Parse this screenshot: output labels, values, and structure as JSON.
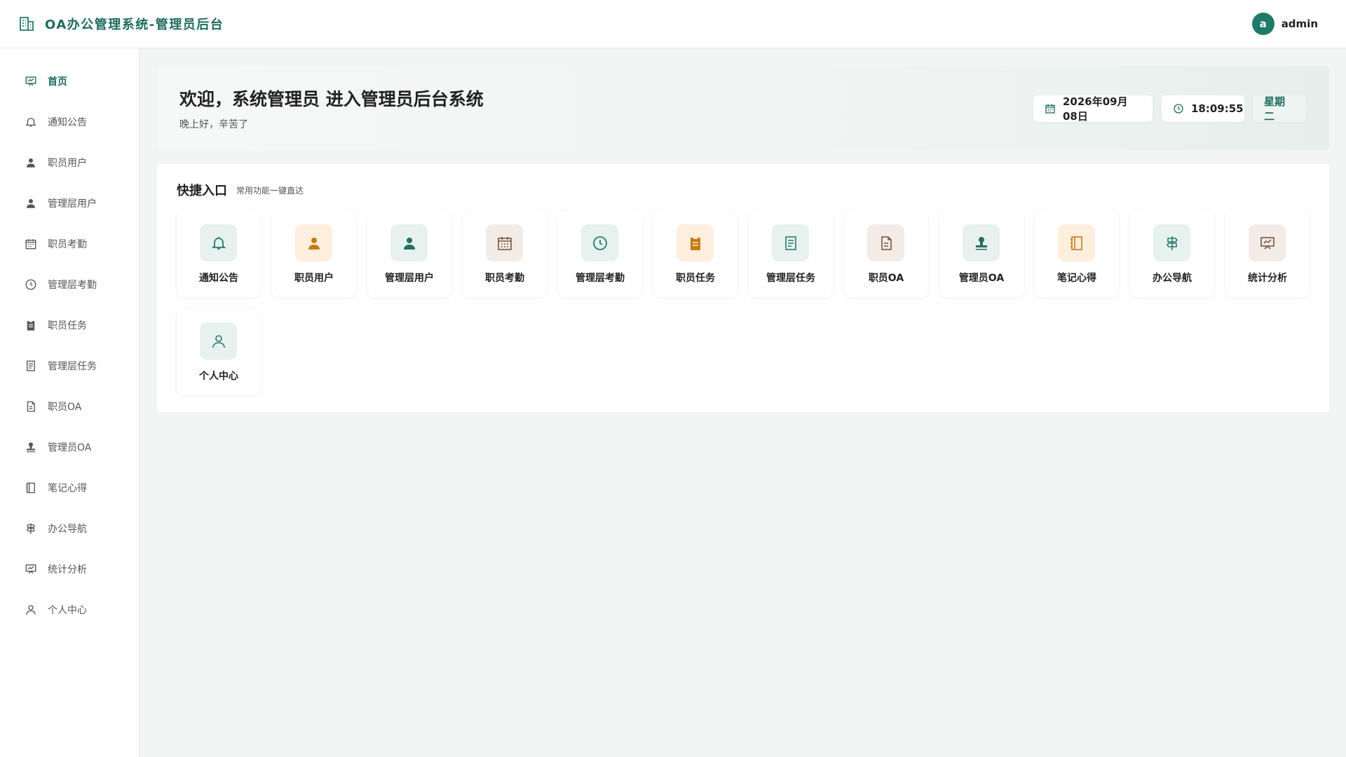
{
  "header": {
    "title": "OA办公管理系统-管理员后台",
    "avatar_letter": "a",
    "username": "admin"
  },
  "sidebar": {
    "items": [
      {
        "label": "首页",
        "icon": "presentation-icon",
        "active": true
      },
      {
        "label": "通知公告",
        "icon": "bell-icon"
      },
      {
        "label": "职员用户",
        "icon": "user-solid-icon"
      },
      {
        "label": "管理层用户",
        "icon": "user-solid-icon"
      },
      {
        "label": "职员考勤",
        "icon": "calendar-icon"
      },
      {
        "label": "管理层考勤",
        "icon": "clock-icon"
      },
      {
        "label": "职员任务",
        "icon": "clipboard-icon"
      },
      {
        "label": "管理层任务",
        "icon": "document-icon"
      },
      {
        "label": "职员OA",
        "icon": "file-icon"
      },
      {
        "label": "管理员OA",
        "icon": "stamp-icon"
      },
      {
        "label": "笔记心得",
        "icon": "notebook-icon"
      },
      {
        "label": "办公导航",
        "icon": "signpost-icon"
      },
      {
        "label": "统计分析",
        "icon": "chart-board-icon"
      },
      {
        "label": "个人中心",
        "icon": "user-outline-icon"
      }
    ]
  },
  "banner": {
    "title": "欢迎，系统管理员 进入管理员后台系统",
    "subtitle": "晚上好，辛苦了",
    "date": "2026年09月08日",
    "time": "18:09:55",
    "weekday": "星期二"
  },
  "quick": {
    "title": "快捷入口",
    "subtitle": "常用功能一键直达",
    "cards": [
      {
        "label": "通知公告",
        "icon": "bell-icon",
        "tint": "green"
      },
      {
        "label": "职员用户",
        "icon": "user-solid-icon",
        "tint": "orange"
      },
      {
        "label": "管理层用户",
        "icon": "user-solid-icon",
        "tint": "green"
      },
      {
        "label": "职员考勤",
        "icon": "calendar-icon",
        "tint": "brown"
      },
      {
        "label": "管理层考勤",
        "icon": "clock-icon",
        "tint": "green"
      },
      {
        "label": "职员任务",
        "icon": "clipboard-icon",
        "tint": "orange"
      },
      {
        "label": "管理层任务",
        "icon": "document-icon",
        "tint": "green"
      },
      {
        "label": "职员OA",
        "icon": "file-icon",
        "tint": "brown"
      },
      {
        "label": "管理员OA",
        "icon": "stamp-icon",
        "tint": "green"
      },
      {
        "label": "笔记心得",
        "icon": "notebook-icon",
        "tint": "orange"
      },
      {
        "label": "办公导航",
        "icon": "signpost-icon",
        "tint": "green"
      },
      {
        "label": "统计分析",
        "icon": "chart-board-icon",
        "tint": "brown"
      },
      {
        "label": "个人中心",
        "icon": "user-outline-icon",
        "tint": "green"
      }
    ]
  },
  "colors": {
    "accent": "#1f6b5e",
    "green_tint": "#e7f1ee",
    "orange_tint": "#fdeedd",
    "brown_tint": "#f3ece6"
  }
}
